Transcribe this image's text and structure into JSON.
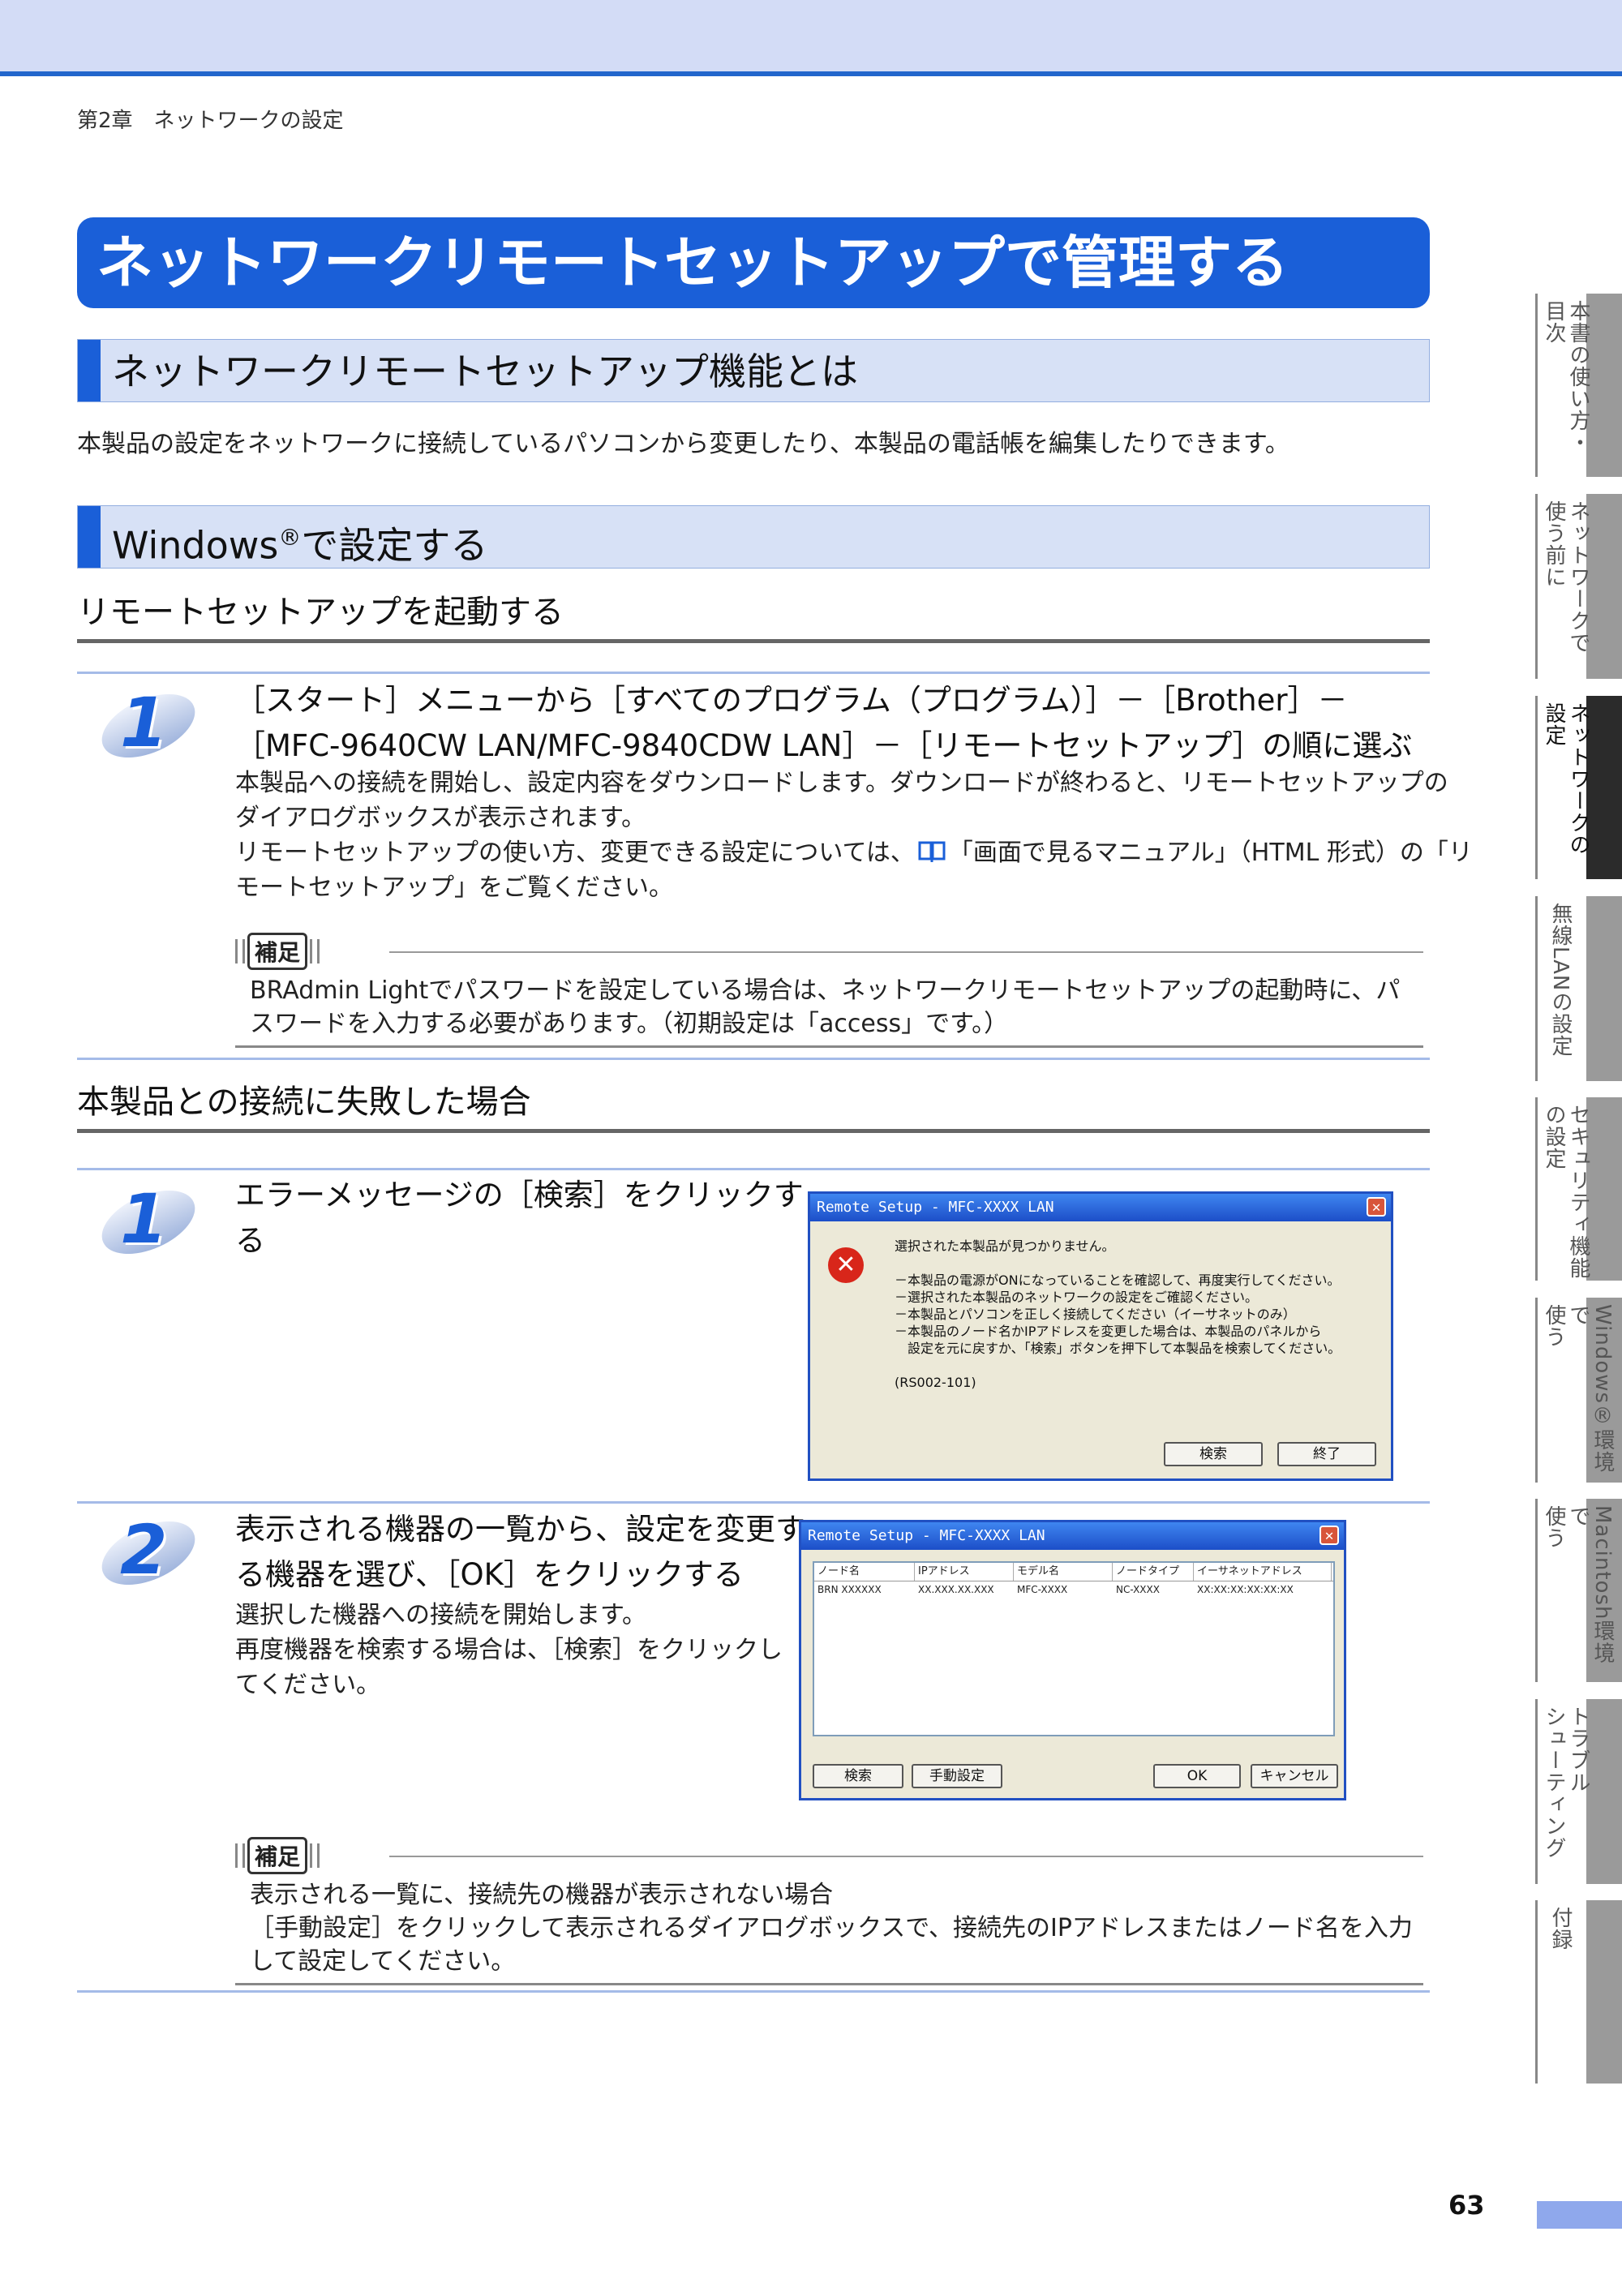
{
  "header": {
    "chapter": "第2章　ネットワークの設定"
  },
  "title": "ネットワークリモートセットアップで管理する",
  "section1": {
    "heading": "ネットワークリモートセットアップ機能とは",
    "text": "本製品の設定をネットワークに接続しているパソコンから変更したり、本製品の電話帳を編集したりできます。"
  },
  "section2": {
    "heading_main": "Windows",
    "heading_sup": "®",
    "heading_rest": "で設定する"
  },
  "sub1": {
    "heading": "リモートセットアップを起動する",
    "step_num": "1",
    "title_line1": "［スタート］メニューから［すべてのプログラム（プログラム）］－［Brother］－",
    "title_line2": "［MFC-9640CW LAN/MFC-9840CDW LAN］－［リモートセットアップ］の順に選ぶ",
    "body_line1": "本製品への接続を開始し、設定内容をダウンロードします。ダウンロードが終わると、リモートセットアップの",
    "body_line2": "ダイアログボックスが表示されます。",
    "body_line3_a": "リモートセットアップの使い方、変更できる設定については、",
    "body_line3_b": "「画面で見るマニュアル」（HTML 形式）の「リ",
    "body_line4": "モートセットアップ」をご覧ください。",
    "note_label": "補足",
    "note_line1": "BRAdmin Lightでパスワードを設定している場合は、ネットワークリモートセットアップの起動時に、パ",
    "note_line2": "スワードを入力する必要があります。（初期設定は「access」です。）"
  },
  "sub2": {
    "heading": "本製品との接続に失敗した場合",
    "step1_num": "1",
    "step1_line1": "エラーメッセージの［検索］をクリックす",
    "step1_line2": "る",
    "step2_num": "2",
    "step2_line1": "表示される機器の一覧から、設定を変更す",
    "step2_line2": "る機器を選び、［OK］をクリックする",
    "step2_body1": "選択した機器への接続を開始します。",
    "step2_body2": "再度機器を検索する場合は、［検索］をクリックし",
    "step2_body3": "てください。",
    "note_label": "補足",
    "note_title": "表示される一覧に、接続先の機器が表示されない場合",
    "note_line1": "［手動設定］をクリックして表示されるダイアログボックスで、接続先のIPアドレスまたはノード名を入力",
    "note_line2": "して設定してください。"
  },
  "dialog1": {
    "title": "Remote Setup - MFC-XXXX LAN",
    "message": "選択された本製品が見つかりません。\n\n－本製品の電源がONになっていることを確認して、再度実行してください。\n－選択された本製品のネットワークの設定をご確認ください。\n－本製品とパソコンを正しく接続してください（イーサネットのみ）\n－本製品のノード名かIPアドレスを変更した場合は、本製品のパネルから\n　設定を元に戻すか、「検索」ボタンを押下して本製品を検索してください。\n\n(RS002-101)",
    "btn_search": "検索",
    "btn_exit": "終了"
  },
  "dialog2": {
    "title": "Remote Setup - MFC-XXXX  LAN",
    "columns": [
      "ノード名",
      "IPアドレス",
      "モデル名",
      "ノードタイプ",
      "イーサネットアドレス"
    ],
    "row": [
      "BRN XXXXXX",
      "XX.XXX.XX.XXX",
      "MFC-XXXX",
      "NC-XXXX",
      "XX:XX:XX:XX:XX:XX"
    ],
    "btn_search": "検索",
    "btn_manual": "手動設定",
    "btn_ok": "OK",
    "btn_cancel": "キャンセル"
  },
  "tabs": [
    {
      "line1": "本書の使い方・",
      "line2": "目次",
      "active": false
    },
    {
      "line1": "ネットワークで",
      "line2": "使う前に",
      "active": false
    },
    {
      "line1": "ネットワークの",
      "line2": "設定",
      "active": true
    },
    {
      "line1": "無線LANの設定",
      "line2": "",
      "active": false
    },
    {
      "line1": "セキュリティ機能",
      "line2": "の設定",
      "active": false
    },
    {
      "line1": "Windows®環境で",
      "line2": "使う",
      "active": false
    },
    {
      "line1": "Macintosh環境で",
      "line2": "使う",
      "active": false
    },
    {
      "line1": "トラブル",
      "line2": "シューティング",
      "active": false
    },
    {
      "line1": "付録",
      "line2": "",
      "active": false
    }
  ],
  "page_number": "63"
}
